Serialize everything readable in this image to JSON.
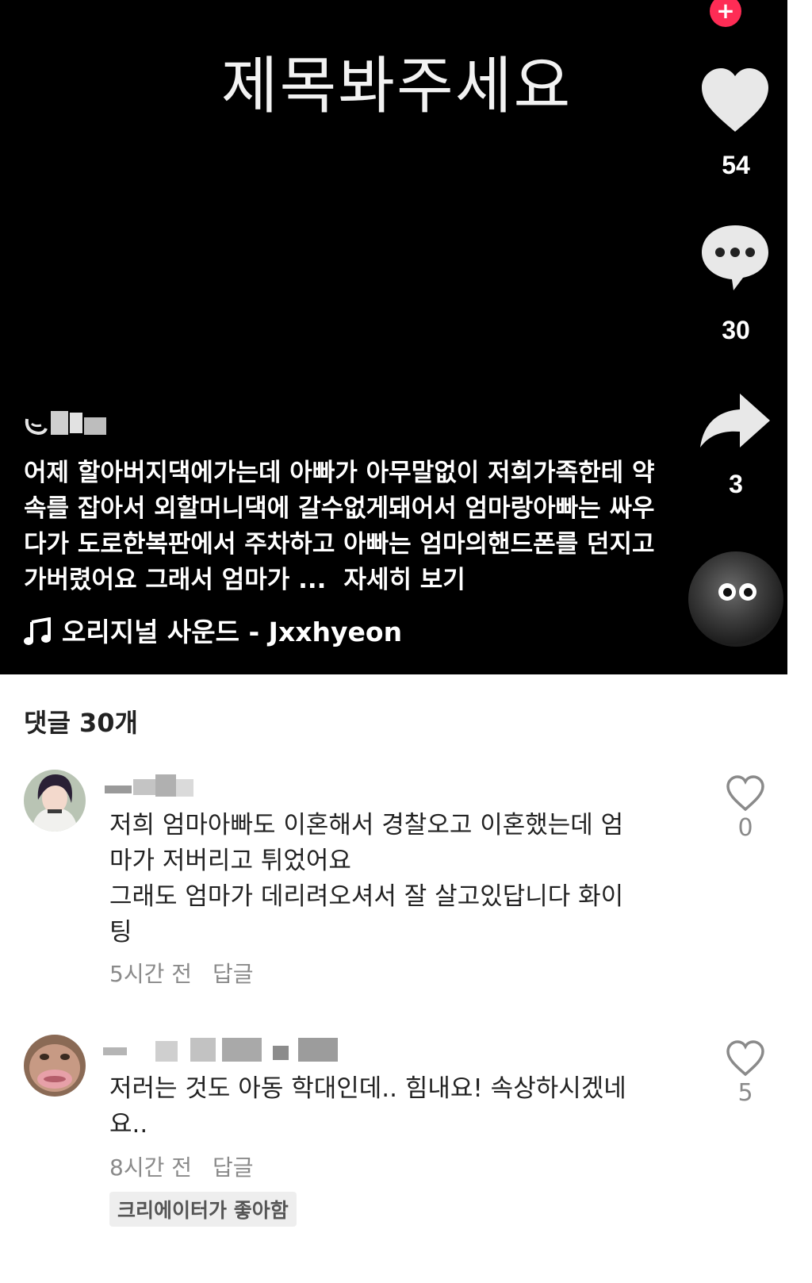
{
  "video": {
    "title": "제목봐주세요",
    "follow_plus": "+",
    "likes": "54",
    "comments": "30",
    "shares": "3",
    "caption": "어제 할아버지댁에가는데 아빠가 아무말없이 저희가족한테 약속를 잡아서 외할머니댁에 갈수없게돼어서 엄마랑아빠는 싸우다가 도로한복판에서 주차하고 아빠는 엄마의핸드폰를 던지고 가버렸어요 그래서 엄마가 ...",
    "more_label": "자세히 보기",
    "music": "오리지널 사운드 - Jxxhyeon"
  },
  "comments_section": {
    "header": "댓글 30개",
    "items": [
      {
        "text_lines": [
          "저희 엄마아빠도 이혼해서 경찰오고 이혼했는데 엄",
          "마가 저버리고 튀었어요",
          "그래도 엄마가 데리려오셔서 잘 살고있답니다 화이",
          "팅"
        ],
        "time": "5시간 전",
        "reply": "답글",
        "likes": "0"
      },
      {
        "text_lines": [
          "저러는 것도 아동 학대인데.. 힘내요! 속상하시겠네",
          "요.."
        ],
        "time": "8시간 전",
        "reply": "답글",
        "likes": "5",
        "badge": "크리에이터가 좋아함"
      }
    ]
  },
  "colors": {
    "accent": "#fe2c55",
    "muted": "#8a8a8a"
  },
  "icons": [
    "heart-icon",
    "comment-bubble-icon",
    "share-arrow-icon",
    "music-note-icon",
    "heart-outline-icon"
  ]
}
